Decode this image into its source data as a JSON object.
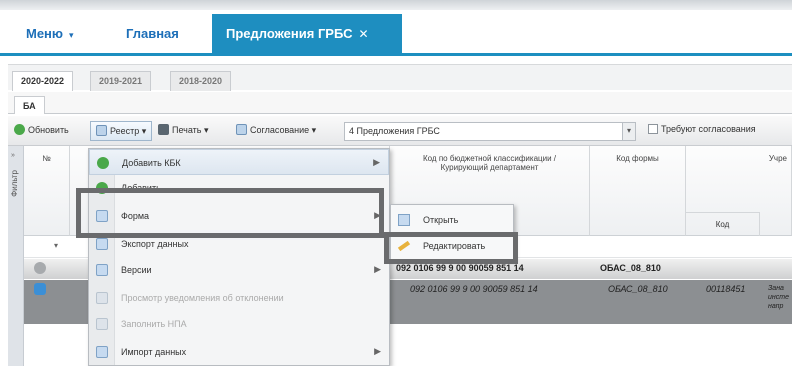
{
  "nav": {
    "menu_label": "Меню",
    "menu_caret": "▾",
    "home_label": "Главная",
    "active_tab_label": "Предложения ГРБС",
    "close_glyph": "✕"
  },
  "year_tabs": [
    "2020-2022",
    "2019-2021",
    "2018-2020"
  ],
  "section_tab": "БА",
  "toolbar": {
    "refresh_label": "Обновить",
    "registry_label": "Реестр",
    "print_label": "Печать",
    "approval_label": "Согласование",
    "dropdown_caret": "▾",
    "combo_value": "4 Предложения ГРБС",
    "combo_caret": "▾",
    "needs_approval_label": "Требуют согласования"
  },
  "filter_panel": {
    "arrows": "»",
    "label": "Фильтр"
  },
  "grid": {
    "col_num": "№",
    "col_kbk": "Код по бюджетной классификации / Курирующий департамент",
    "col_form": "Код формы",
    "col_institution": "Учре",
    "sub_code": "Код",
    "filter_caret": "▾",
    "rows": [
      {
        "kbk": "092 0106 99 9 00 90059 851 14",
        "form": "ОБАС_08_810",
        "code": "",
        "extra": ""
      },
      {
        "kbk": "092 0106 99 9 00 90059 851 14",
        "form": "ОБАС_08_810",
        "code": "00118451",
        "extra": "Зана инсте напр"
      }
    ]
  },
  "context_menu": {
    "items": [
      {
        "label": "Добавить КБК",
        "icon": "add-icon",
        "submenu": true,
        "disabled": false
      },
      {
        "label": "Добавить ...",
        "icon": "add-icon",
        "submenu": false,
        "disabled": false
      },
      {
        "label": "Форма",
        "icon": "form-icon",
        "submenu": true,
        "disabled": false
      },
      {
        "label": "Экспорт данных",
        "icon": "export-icon",
        "submenu": true,
        "disabled": false
      },
      {
        "label": "Версии",
        "icon": "versions-icon",
        "submenu": true,
        "disabled": false
      },
      {
        "label": "Просмотр уведомления об отклонении",
        "icon": "notice-icon",
        "submenu": false,
        "disabled": true
      },
      {
        "label": "Заполнить НПА",
        "icon": "fill-icon",
        "submenu": false,
        "disabled": true
      },
      {
        "label": "Импорт данных",
        "icon": "import-icon",
        "submenu": true,
        "disabled": false
      }
    ],
    "arrow_glyph": "▶"
  },
  "form_submenu": {
    "open_label": "Открыть",
    "edit_label": "Редактировать"
  },
  "colors": {
    "accent": "#1e8ec0",
    "link": "#1d6fb8",
    "highlight_frame": "#6a6b6d"
  }
}
